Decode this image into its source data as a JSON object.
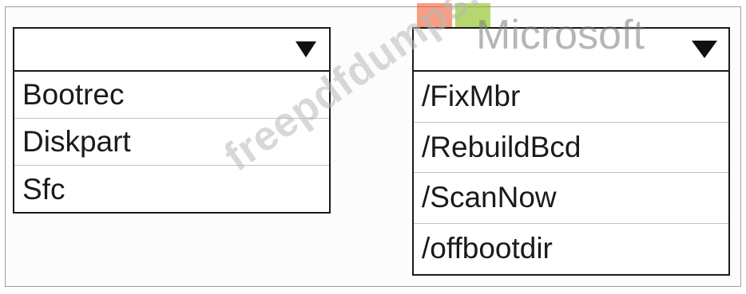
{
  "watermark": {
    "brand_text": "Microsoft",
    "site_text": "freepdfdumps.com",
    "logo_colors": [
      "#f25022",
      "#7fba00",
      "#00a4ef",
      "#ffb900"
    ]
  },
  "dropdown_left": {
    "selected": "",
    "arrow_icon": "triangle-down-icon",
    "options": [
      "Bootrec",
      "Diskpart",
      "Sfc"
    ]
  },
  "dropdown_right": {
    "selected": "",
    "arrow_icon": "triangle-down-icon",
    "options": [
      "/FixMbr",
      "/RebuildBcd",
      "/ScanNow",
      "/offbootdir"
    ]
  }
}
